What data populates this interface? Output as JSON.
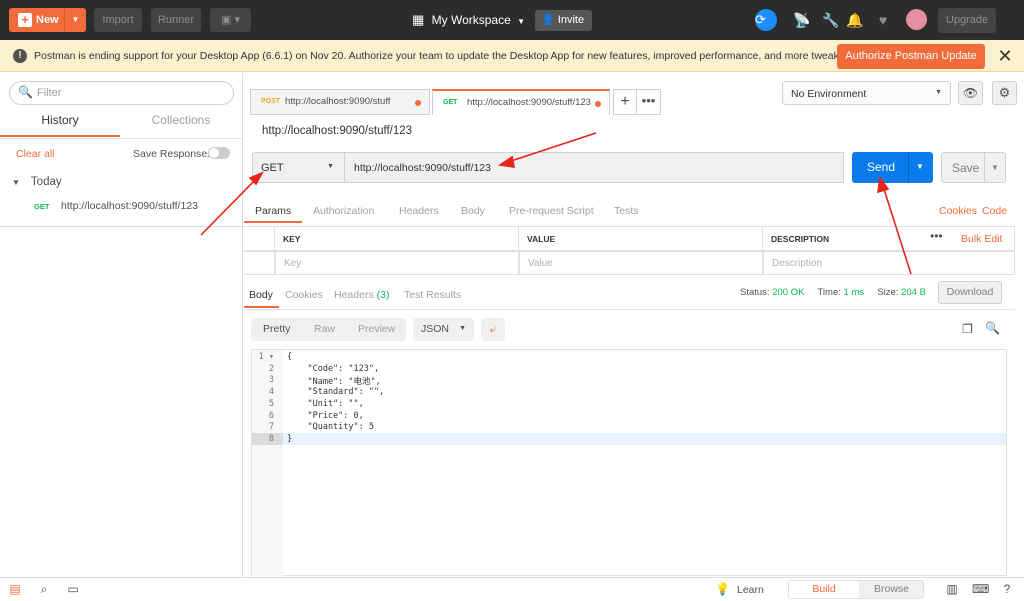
{
  "topbar": {
    "new_label": "New",
    "import_label": "Import",
    "runner_label": "Runner",
    "workspace_label": "My Workspace",
    "invite_label": "Invite",
    "upgrade_label": "Upgrade"
  },
  "banner": {
    "text": "Postman is ending support for your Desktop App (6.6.1) on Nov 20. Authorize your team to update the Desktop App for new features, improved performance, and more tweaks.",
    "button_label": "Authorize Postman Update",
    "close_glyph": "✕"
  },
  "sidebar": {
    "filter_placeholder": "Filter",
    "tabs": [
      "History",
      "Collections"
    ],
    "clear_all": "Clear all",
    "save_responses": "Save Responses",
    "group_label": "Today",
    "items": [
      {
        "method": "GET",
        "url": "http://localhost:9090/stuff/123"
      }
    ]
  },
  "request_tabs": [
    {
      "method": "POST",
      "url": "http://localhost:9090/stuff",
      "method_color": "#f5a623"
    },
    {
      "method": "GET",
      "url": "http://localhost:9090/stuff/123",
      "method_color": "#0cbb52"
    }
  ],
  "environment": {
    "selected": "No Environment"
  },
  "request": {
    "title": "http://localhost:9090/stuff/123",
    "method": "GET",
    "url": "http://localhost:9090/stuff/123",
    "send_label": "Send",
    "save_label": "Save",
    "tabs": [
      "Params",
      "Authorization",
      "Headers",
      "Body",
      "Pre-request Script",
      "Tests"
    ],
    "cookies_label": "Cookies",
    "code_label": "Code"
  },
  "params_table": {
    "headers": [
      "KEY",
      "VALUE",
      "DESCRIPTION"
    ],
    "placeholders": [
      "Key",
      "Value",
      "Description"
    ],
    "bulk_edit": "Bulk Edit",
    "more": "•••"
  },
  "response": {
    "tabs": [
      "Body",
      "Cookies",
      "Headers",
      "Test Results"
    ],
    "headers_count": "(3)",
    "status_label": "Status:",
    "status_value": "200 OK",
    "time_label": "Time:",
    "time_value": "1 ms",
    "size_label": "Size:",
    "size_value": "204 B",
    "download_label": "Download",
    "view_modes": [
      "Pretty",
      "Raw",
      "Preview"
    ],
    "format": "JSON",
    "code_lines": [
      "{",
      "    \"Code\": \"123\",",
      "    \"Name\": \"电池\",",
      "    \"Standard\": \"\",",
      "    \"Unit\": \"\",",
      "    \"Price\": 0,",
      "    \"Quantity\": 5",
      "}"
    ]
  },
  "bottombar": {
    "learn_label": "Learn",
    "build_label": "Build",
    "browse_label": "Browse"
  },
  "colors": {
    "accent": "#f26b3a",
    "send_blue": "#097bed",
    "status_green": "#0cbb52",
    "annotation_red": "#e8241c"
  }
}
